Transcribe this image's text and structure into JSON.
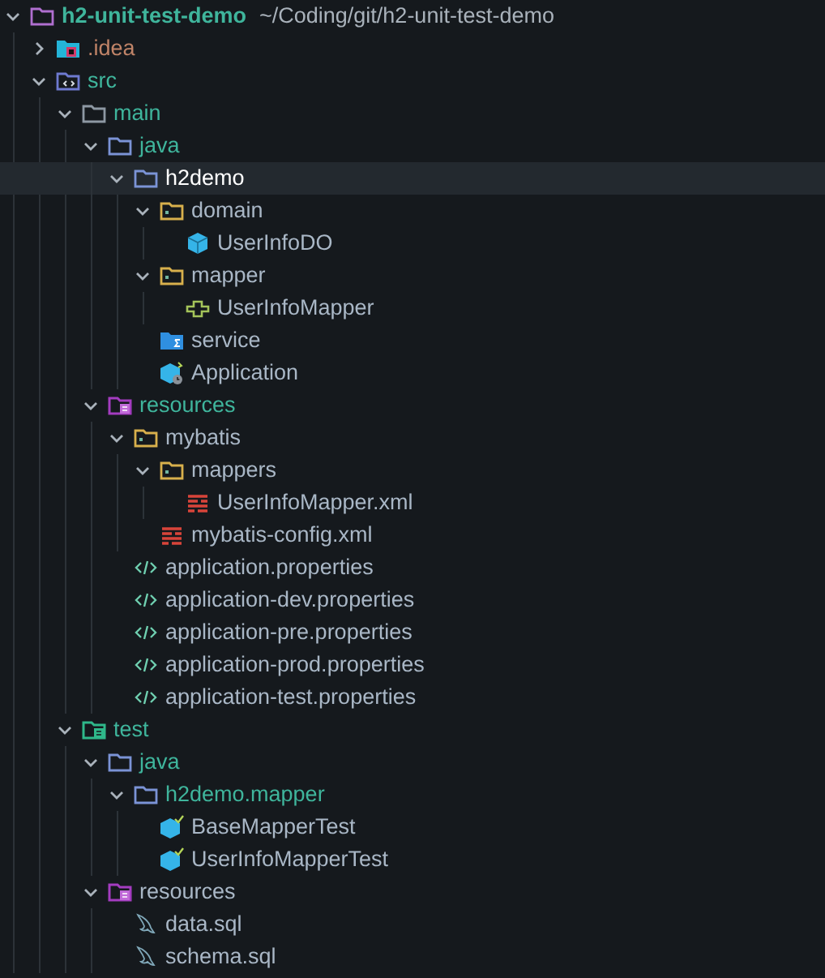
{
  "tree": [
    {
      "name": "h2-unit-test-demo",
      "path": "~/Coding/git/h2-unit-test-demo",
      "kind": "project",
      "color": "#3fb59c",
      "expanded": true,
      "selected": false,
      "children": [
        {
          "name": ".idea",
          "kind": "idea",
          "color": "#c08468",
          "expanded": false,
          "selected": false
        },
        {
          "name": "src",
          "kind": "src",
          "color": "#3fb59c",
          "expanded": true,
          "selected": false,
          "children": [
            {
              "name": "main",
              "kind": "folder",
              "color": "#3fb59c",
              "expanded": true,
              "selected": false,
              "children": [
                {
                  "name": "java",
                  "kind": "source",
                  "color": "#3fb59c",
                  "expanded": true,
                  "selected": false,
                  "children": [
                    {
                      "name": "h2demo",
                      "kind": "source",
                      "color": "#ffffff",
                      "expanded": true,
                      "selected": true,
                      "children": [
                        {
                          "name": "domain",
                          "kind": "package",
                          "color": "#a9b7c6",
                          "expanded": true,
                          "selected": false,
                          "children": [
                            {
                              "name": "UserInfoDO",
                              "kind": "class",
                              "color": "#a9b7c6",
                              "selected": false
                            }
                          ]
                        },
                        {
                          "name": "mapper",
                          "kind": "package",
                          "color": "#a9b7c6",
                          "expanded": true,
                          "selected": false,
                          "children": [
                            {
                              "name": "UserInfoMapper",
                              "kind": "interface",
                              "color": "#a9b7c6",
                              "selected": false
                            }
                          ]
                        },
                        {
                          "name": "service",
                          "kind": "service",
                          "color": "#a9b7c6",
                          "selected": false
                        },
                        {
                          "name": "Application",
                          "kind": "app",
                          "color": "#a9b7c6",
                          "selected": false
                        }
                      ]
                    }
                  ]
                },
                {
                  "name": "resources",
                  "kind": "resources",
                  "color": "#3fb59c",
                  "expanded": true,
                  "selected": false,
                  "children": [
                    {
                      "name": "mybatis",
                      "kind": "package",
                      "color": "#a9b7c6",
                      "expanded": true,
                      "selected": false,
                      "children": [
                        {
                          "name": "mappers",
                          "kind": "package",
                          "color": "#a9b7c6",
                          "expanded": true,
                          "selected": false,
                          "children": [
                            {
                              "name": "UserInfoMapper.xml",
                              "kind": "xml",
                              "color": "#a9b7c6",
                              "selected": false
                            }
                          ]
                        },
                        {
                          "name": "mybatis-config.xml",
                          "kind": "xml",
                          "color": "#a9b7c6",
                          "selected": false
                        }
                      ]
                    },
                    {
                      "name": "application.properties",
                      "kind": "properties",
                      "color": "#a9b7c6",
                      "selected": false
                    },
                    {
                      "name": "application-dev.properties",
                      "kind": "properties",
                      "color": "#a9b7c6",
                      "selected": false
                    },
                    {
                      "name": "application-pre.properties",
                      "kind": "properties",
                      "color": "#a9b7c6",
                      "selected": false
                    },
                    {
                      "name": "application-prod.properties",
                      "kind": "properties",
                      "color": "#a9b7c6",
                      "selected": false
                    },
                    {
                      "name": "application-test.properties",
                      "kind": "properties",
                      "color": "#a9b7c6",
                      "selected": false
                    }
                  ]
                }
              ]
            },
            {
              "name": "test",
              "kind": "test",
              "color": "#3fb59c",
              "expanded": true,
              "selected": false,
              "children": [
                {
                  "name": "java",
                  "kind": "source",
                  "color": "#3fb59c",
                  "expanded": true,
                  "selected": false,
                  "children": [
                    {
                      "name": "h2demo.mapper",
                      "kind": "source",
                      "color": "#3fb59c",
                      "expanded": true,
                      "selected": false,
                      "children": [
                        {
                          "name": "BaseMapperTest",
                          "kind": "testclass",
                          "color": "#a9b7c6",
                          "selected": false
                        },
                        {
                          "name": "UserInfoMapperTest",
                          "kind": "testclass",
                          "color": "#a9b7c6",
                          "selected": false
                        }
                      ]
                    }
                  ]
                },
                {
                  "name": "resources",
                  "kind": "resources",
                  "color": "#a9b7c6",
                  "expanded": true,
                  "selected": false,
                  "children": [
                    {
                      "name": "data.sql",
                      "kind": "sql",
                      "color": "#a9b7c6",
                      "selected": false
                    },
                    {
                      "name": "schema.sql",
                      "kind": "sql",
                      "color": "#a9b7c6",
                      "selected": false
                    }
                  ]
                }
              ]
            }
          ]
        }
      ]
    }
  ]
}
